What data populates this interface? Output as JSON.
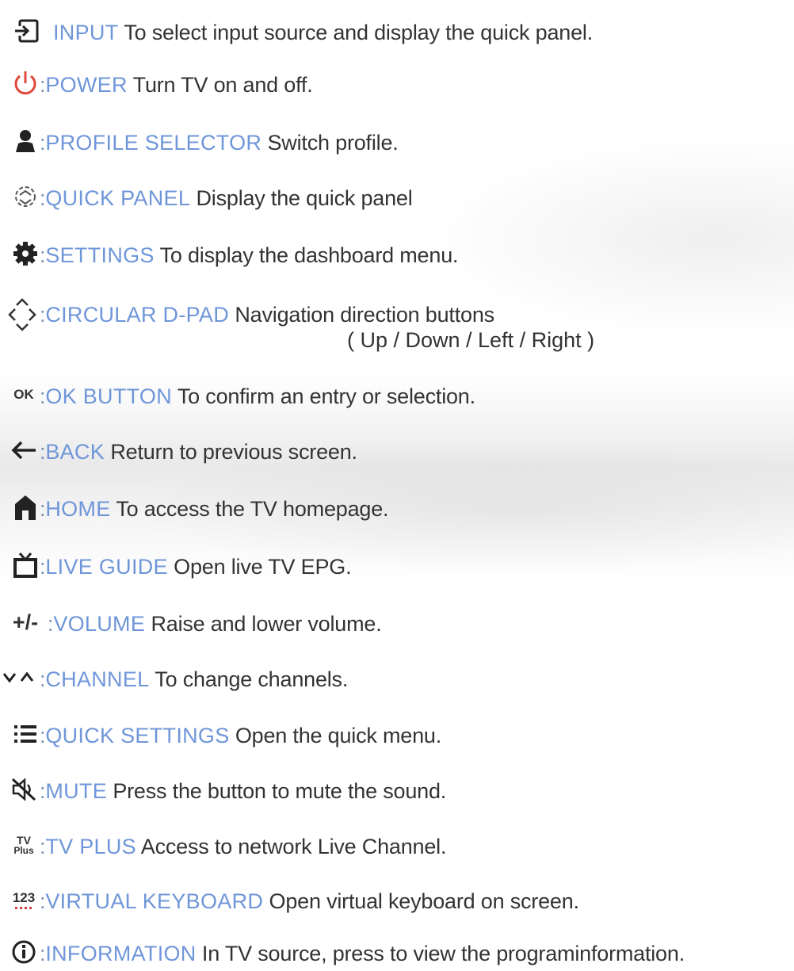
{
  "items": [
    {
      "key": "INPUT",
      "description": "To select input source and display the quick panel.",
      "icon": "input-icon"
    },
    {
      "key": "POWER",
      "description": "Turn TV on and off.",
      "icon": "power-icon"
    },
    {
      "key": "PROFILE SELECTOR",
      "description": "Switch profile.",
      "icon": "profile-icon"
    },
    {
      "key": "QUICK PANEL",
      "description": "Display the quick panel",
      "icon": "quick-panel-icon"
    },
    {
      "key": "SETTINGS",
      "description": "To display the dashboard menu.",
      "icon": "gear-icon"
    },
    {
      "key": "CIRCULAR D-PAD",
      "description": "Navigation direction buttons",
      "description_line2": "( Up / Down / Left / Right )",
      "icon": "dpad-icon"
    },
    {
      "key": "OK BUTTON",
      "description": "To confirm an entry or selection.",
      "icon": "ok-icon",
      "icon_text": "OK"
    },
    {
      "key": "BACK",
      "description": "Return to previous screen.",
      "icon": "back-arrow-icon"
    },
    {
      "key": "HOME",
      "description": "To access the TV homepage.",
      "icon": "home-icon"
    },
    {
      "key": "LIVE GUIDE",
      "description": "Open live TV EPG.",
      "icon": "tv-guide-icon"
    },
    {
      "key": "VOLUME",
      "description": "Raise and lower volume.",
      "icon": "volume-icon",
      "icon_text": "+/-"
    },
    {
      "key": "CHANNEL",
      "description": "To change channels.",
      "icon": "channel-icon"
    },
    {
      "key": "QUICK SETTINGS",
      "description": "Open the quick menu.",
      "icon": "list-icon"
    },
    {
      "key": "MUTE",
      "description": "Press the button to mute the sound.",
      "icon": "mute-icon"
    },
    {
      "key": "TV PLUS",
      "description": "Access to network Live Channel.",
      "icon": "tv-plus-icon",
      "icon_text": [
        "TV",
        "Plus"
      ]
    },
    {
      "key": "VIRTUAL KEYBOARD",
      "description": "Open virtual keyboard on screen.",
      "icon": "keyboard-123-icon",
      "icon_text": "123"
    },
    {
      "key": "INFORMATION",
      "description": "In TV source, press to view the programinformation.",
      "icon": "info-icon"
    }
  ],
  "separator": ":",
  "colors": {
    "key": "#6f96d9",
    "text": "#333333",
    "power": "#e0483a",
    "background": "#ffffff"
  }
}
